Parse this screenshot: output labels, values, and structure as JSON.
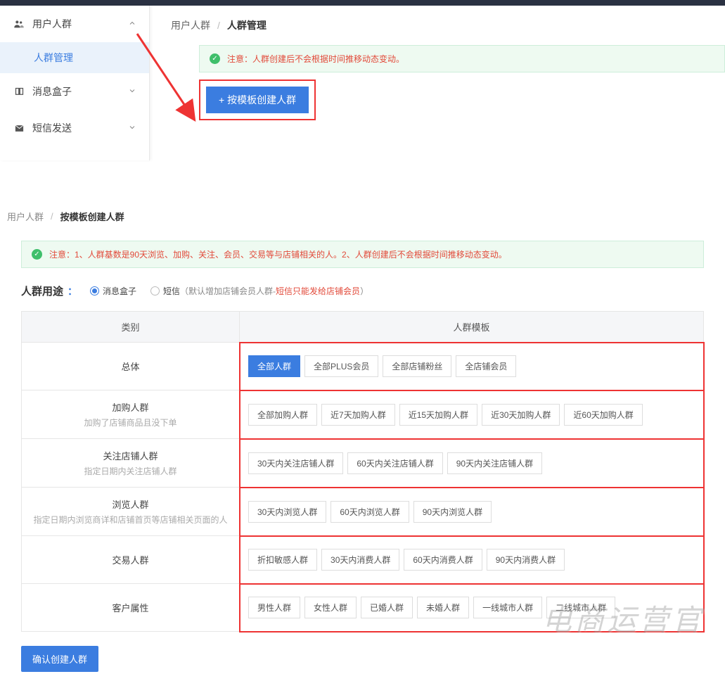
{
  "sidebar": {
    "items": [
      {
        "icon": "users",
        "label": "用户人群",
        "expanded": true
      },
      {
        "icon": "book",
        "label": "消息盒子",
        "expanded": false
      },
      {
        "icon": "mail",
        "label": "短信发送",
        "expanded": false
      }
    ],
    "sub_item": "人群管理"
  },
  "section1": {
    "breadcrumb": {
      "a": "用户人群",
      "b": "人群管理"
    },
    "alert": "注意：人群创建后不会根据时间推移动态变动。",
    "create_btn": "+ 按模板创建人群"
  },
  "section2": {
    "breadcrumb": {
      "a": "用户人群",
      "b": "按模板创建人群"
    },
    "alert": "注意：1、人群基数是90天浏览、加购、关注、会员、交易等与店铺相关的人。2、人群创建后不会根据时间推移动态变动。",
    "purpose": {
      "label": "人群用途",
      "options": [
        {
          "label": "消息盒子",
          "selected": true
        },
        {
          "label": "短信",
          "selected": false,
          "note_prefix": "（默认增加店铺会员人群-",
          "note_red": "短信只能发给店铺会员",
          "note_suffix": "）"
        }
      ]
    },
    "table": {
      "headers": [
        "类别",
        "人群模板"
      ],
      "rows": [
        {
          "cat": "总体",
          "sub": "",
          "tags": [
            "全部人群",
            "全部PLUS会员",
            "全部店铺粉丝",
            "全店铺会员"
          ],
          "active_index": 0
        },
        {
          "cat": "加购人群",
          "sub": "加购了店铺商品且没下单",
          "tags": [
            "全部加购人群",
            "近7天加购人群",
            "近15天加购人群",
            "近30天加购人群",
            "近60天加购人群"
          ]
        },
        {
          "cat": "关注店铺人群",
          "sub": "指定日期内关注店铺人群",
          "tags": [
            "30天内关注店铺人群",
            "60天内关注店铺人群",
            "90天内关注店铺人群"
          ]
        },
        {
          "cat": "浏览人群",
          "sub": "指定日期内浏览商详和店铺首页等店铺相关页面的人",
          "tags": [
            "30天内浏览人群",
            "60天内浏览人群",
            "90天内浏览人群"
          ]
        },
        {
          "cat": "交易人群",
          "sub": "",
          "tags": [
            "折扣敏感人群",
            "30天内消费人群",
            "60天内消费人群",
            "90天内消费人群"
          ]
        },
        {
          "cat": "客户属性",
          "sub": "",
          "tags": [
            "男性人群",
            "女性人群",
            "已婚人群",
            "未婚人群",
            "一线城市人群",
            "二线城市人群"
          ]
        }
      ]
    },
    "confirm_btn": "确认创建人群"
  },
  "watermark": "电商运营官"
}
